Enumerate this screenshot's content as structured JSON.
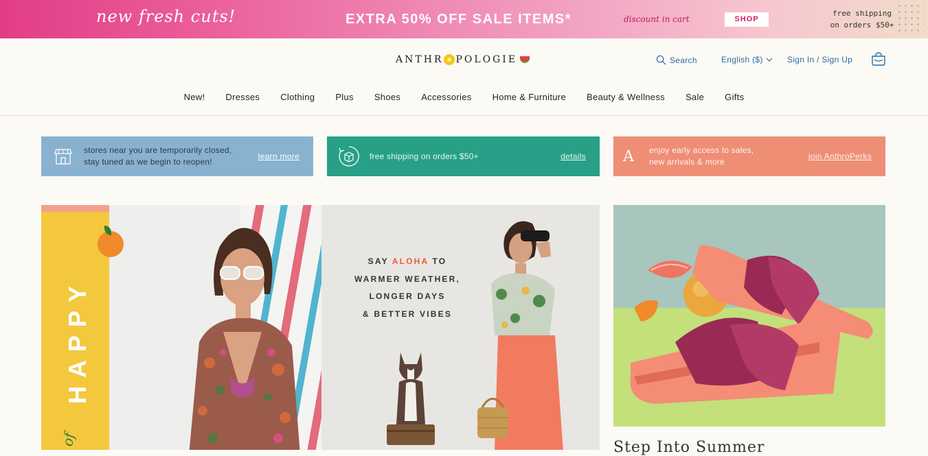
{
  "promo": {
    "script_text": "new fresh cuts!",
    "headline": "EXTRA 50% OFF SALE ITEMS*",
    "discount_note": "discount in cart",
    "shop_label": "SHOP",
    "shipping_line1": "free shipping",
    "shipping_line2": "on orders $50+"
  },
  "header": {
    "logo_pre": "ANTHR",
    "logo_post": "POLOGIE",
    "search_label": "Search",
    "language_label": "English ($)",
    "signin_label": "Sign In / Sign Up",
    "bag_icon": "shopping-bag-icon"
  },
  "nav": {
    "items": [
      "New!",
      "Dresses",
      "Clothing",
      "Plus",
      "Shoes",
      "Accessories",
      "Home & Furniture",
      "Beauty & Wellness",
      "Sale",
      "Gifts"
    ]
  },
  "tiles": [
    {
      "text_line1": "stores near you are temporarily closed,",
      "text_line2": "stay tuned as we begin to reopen!",
      "link": "learn more",
      "icon": "storefront-icon",
      "color": "#89b2d0"
    },
    {
      "text_line1": "free shipping on orders $50+",
      "text_line2": "",
      "link": "details",
      "icon": "box-return-icon",
      "color": "#27a087"
    },
    {
      "text_line1": "enjoy early access to sales,",
      "text_line2": "new arrivals & more",
      "link": "join AnthroPerks",
      "icon_letter": "A",
      "color": "#ee8e75"
    }
  ],
  "hero": {
    "happy_text": "HAPPY",
    "of_text": "of",
    "aloha_line1_pre": "SAY ",
    "aloha_accent": "ALOHA",
    "aloha_line1_post": " TO",
    "aloha_line2": "WARMER WEATHER,",
    "aloha_line3": "LONGER DAYS",
    "aloha_line4": "& BETTER VIBES"
  },
  "side": {
    "caption": "Step Into Summer"
  },
  "colors": {
    "accent_blue": "#2b6ba0",
    "promo_pink": "#e23d86"
  }
}
